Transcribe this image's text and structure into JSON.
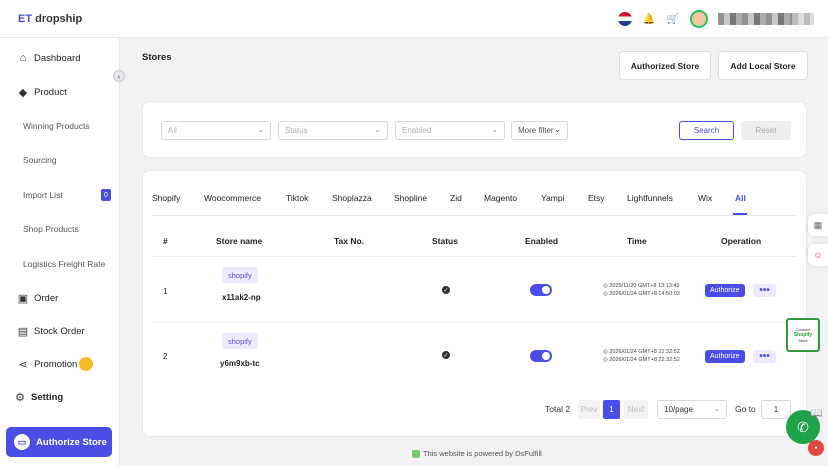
{
  "app": {
    "logo_prefix": "ET",
    "logo_suffix": " dropship"
  },
  "sidebar": {
    "items": [
      {
        "label": "Dashboard",
        "icon": "home-icon"
      },
      {
        "label": "Product",
        "icon": "cube-icon"
      },
      {
        "label": "Winning Products"
      },
      {
        "label": "Sourcing"
      },
      {
        "label": "Import List",
        "badge": "0"
      },
      {
        "label": "Shop Products"
      },
      {
        "label": "Logistics Freight Rate"
      },
      {
        "label": "Order",
        "icon": "order-icon"
      },
      {
        "label": "Stock Order",
        "icon": "clipboard-icon"
      },
      {
        "label": "Promotion",
        "icon": "share-icon"
      },
      {
        "label": "Setting",
        "icon": "gear-icon"
      }
    ],
    "authorize_store_label": "Authorize Store"
  },
  "page": {
    "title": "Stores",
    "authorized_store_label": "Authorized Store",
    "add_local_store_label": "Add Local Store"
  },
  "filters": {
    "platform": "All",
    "status": "Status",
    "enabled": "Enabled",
    "more_filter": "More filter",
    "search_label": "Search",
    "reset_label": "Reset"
  },
  "tabs": [
    "Shopify",
    "Woocommerce",
    "Tiktok",
    "Shoplazza",
    "Shopline",
    "Zid",
    "Magento",
    "Yampi",
    "Etsy",
    "Lightfunnels",
    "Wix",
    "All"
  ],
  "table": {
    "headers": [
      "#",
      "Store name",
      "Tax No.",
      "Status",
      "Enabled",
      "Time",
      "Operation"
    ],
    "rows": [
      {
        "index": "1",
        "platform": "shopify",
        "store_name": "x11ak2-np",
        "time_created": "◎ 2025/11/20 GMT+8 13:13:49",
        "time_updated": "◎ 2026/01/24 GMT+8 14:50:03",
        "authorize_label": "Authorize",
        "more_label": "•••"
      },
      {
        "index": "2",
        "platform": "shopify",
        "store_name": "y6m9xb-tc",
        "time_created": "◎ 2026/01/24 GMT+8 22:32:52",
        "time_updated": "◎ 2026/01/24 GMT+8 22:32:52",
        "authorize_label": "Authorize",
        "more_label": "•••"
      }
    ]
  },
  "pagination": {
    "total": "Total 2",
    "prev": "Prev",
    "current": "1",
    "next": "Next",
    "page_size": "10/page",
    "goto_label": "Go to",
    "goto_value": "1"
  },
  "footer": {
    "text": "This website is powered by DsFulfill"
  },
  "promo_widget": {
    "line1": "Connect",
    "line2": "Shopify",
    "line3": "Store"
  },
  "colors": {
    "accent": "#4b4ee6",
    "promo_dot": "#f7b928"
  }
}
